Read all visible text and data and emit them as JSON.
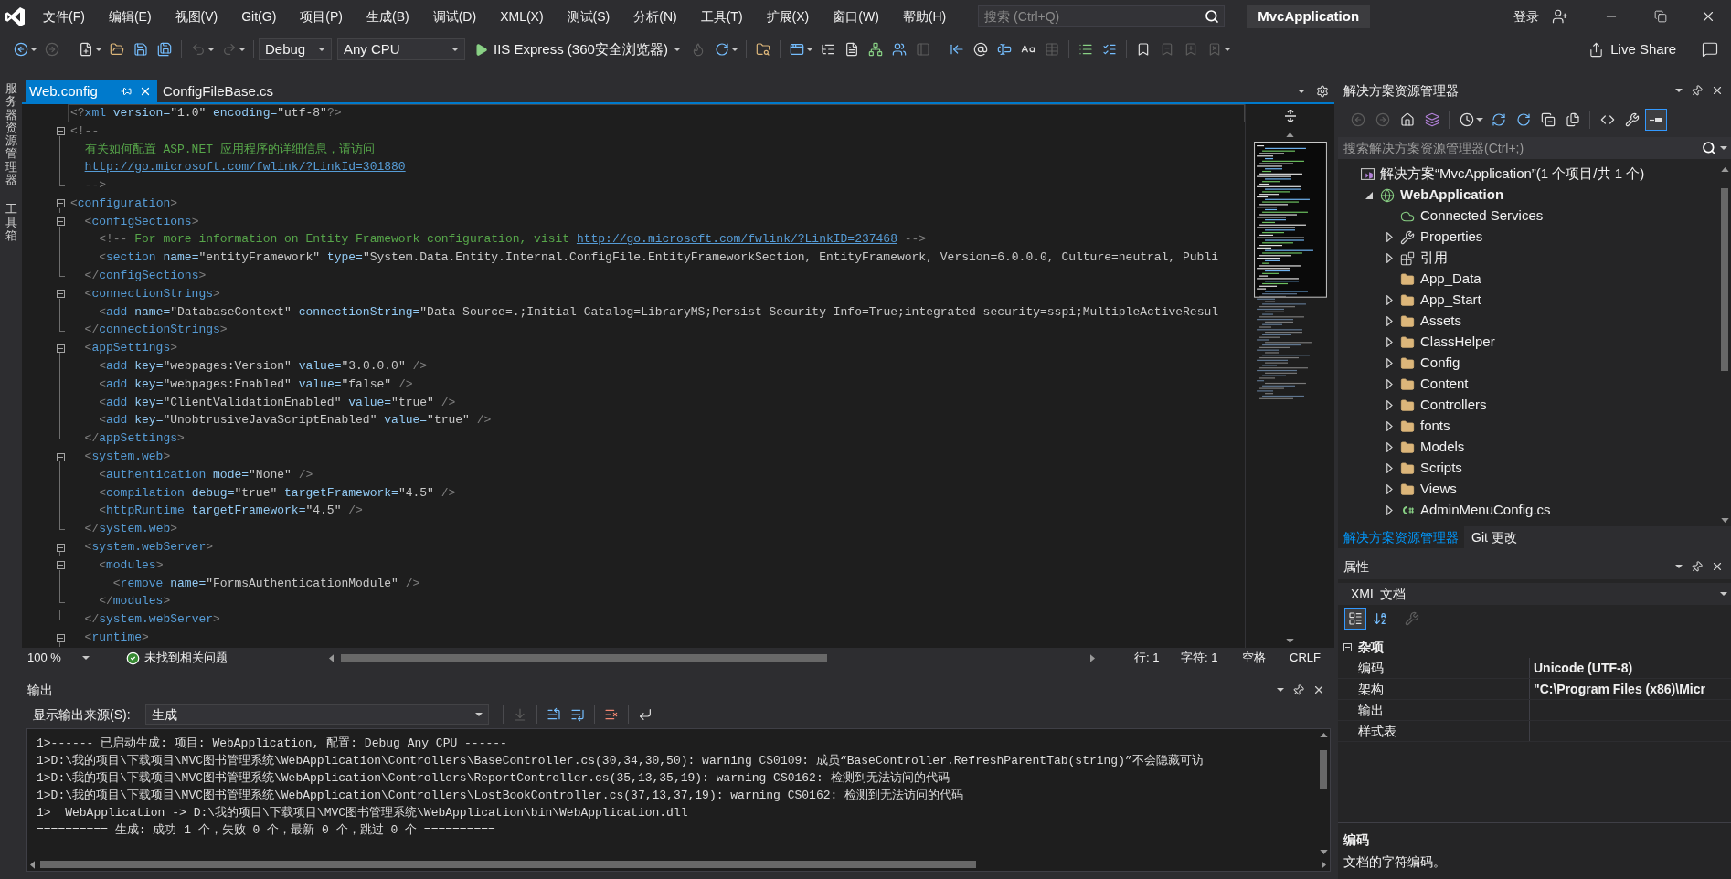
{
  "menu_bar": {
    "items": [
      "文件(F)",
      "编辑(E)",
      "视图(V)",
      "Git(G)",
      "项目(P)",
      "生成(B)",
      "调试(D)",
      "XML(X)",
      "测试(S)",
      "分析(N)",
      "工具(T)",
      "扩展(X)",
      "窗口(W)",
      "帮助(H)"
    ],
    "search": {
      "placeholder": "搜索 (Ctrl+Q)"
    },
    "title": "MvcApplication",
    "sign_in": "登录"
  },
  "toolbar": {
    "groups": [
      [
        {
          "kind": "back",
          "disabled": false,
          "menu": true
        },
        {
          "kind": "forward",
          "disabled": true,
          "menu": false
        }
      ],
      [
        {
          "kind": "new-item",
          "disabled": false,
          "menu": true
        },
        {
          "kind": "open",
          "disabled": false,
          "menu": false
        },
        {
          "kind": "save",
          "disabled": false,
          "menu": false
        },
        {
          "kind": "save-all",
          "disabled": false,
          "menu": false
        }
      ],
      [
        {
          "kind": "undo",
          "disabled": true,
          "menu": true
        },
        {
          "kind": "redo",
          "disabled": true,
          "menu": true
        }
      ],
      [
        {
          "kind": "combo",
          "value": "Debug",
          "disabled": false
        },
        {
          "kind": "combo",
          "value": "Any CPU",
          "disabled": false
        },
        {
          "kind": "run",
          "label": "IIS Express (360安全浏览器)",
          "disabled": false,
          "menu": true
        },
        {
          "kind": "hot-reload",
          "disabled": true,
          "menu": false
        },
        {
          "kind": "restart",
          "disabled": false,
          "menu": true
        }
      ],
      [
        {
          "kind": "find-folder",
          "disabled": false,
          "menu": false
        }
      ],
      [
        {
          "kind": "browse",
          "disabled": false,
          "menu": true
        },
        {
          "kind": "outline",
          "disabled": false,
          "menu": false
        },
        {
          "kind": "document",
          "disabled": false,
          "menu": false
        },
        {
          "kind": "hierarchy",
          "disabled": false,
          "menu": false
        },
        {
          "kind": "people",
          "disabled": false,
          "menu": false
        },
        {
          "kind": "panel",
          "disabled": true,
          "menu": false
        }
      ],
      [
        {
          "kind": "outdent",
          "disabled": false,
          "menu": false
        },
        {
          "kind": "at",
          "disabled": false,
          "menu": false
        },
        {
          "kind": "insert",
          "disabled": false,
          "menu": false
        },
        {
          "kind": "format",
          "disabled": false,
          "menu": false
        },
        {
          "kind": "table",
          "disabled": true,
          "menu": false
        }
      ],
      [
        {
          "kind": "comment",
          "disabled": false,
          "menu": false
        },
        {
          "kind": "uncomment",
          "disabled": false,
          "menu": false
        }
      ],
      [
        {
          "kind": "bookmark",
          "disabled": false,
          "menu": false
        },
        {
          "kind": "bookmark-prev",
          "disabled": true,
          "menu": false
        },
        {
          "kind": "bookmark-next",
          "disabled": true,
          "menu": false
        },
        {
          "kind": "bookmark-clear",
          "disabled": true,
          "menu": true
        }
      ]
    ],
    "live_share": "Live Share"
  },
  "side_tabs": [
    "服务器资源管理器",
    "工具箱"
  ],
  "editor": {
    "tabs": [
      {
        "label": "Web.config",
        "selected": true
      },
      {
        "label": "ConfigFileBase.cs",
        "selected": false
      }
    ],
    "lines": [
      {
        "kind": "plain",
        "current": true,
        "tokens": [
          {
            "kind": "delimiter",
            "text": "<?"
          },
          {
            "kind": "element",
            "text": "xml"
          },
          {
            "kind": "attribute",
            "text": " version="
          },
          {
            "kind": "value",
            "text": "\"1.0\""
          },
          {
            "kind": "attribute",
            "text": " encoding="
          },
          {
            "kind": "value",
            "text": "\"utf-8\""
          },
          {
            "kind": "delimiter",
            "text": "?>"
          }
        ]
      },
      {
        "kind": "start",
        "current": false,
        "tokens": [
          {
            "kind": "delimiter",
            "text": "<!--"
          }
        ]
      },
      {
        "kind": "inner",
        "current": false,
        "tokens": [
          {
            "kind": "comment",
            "text": "  有关如何配置 ASP.NET 应用程序的详细信息，请访问"
          }
        ]
      },
      {
        "kind": "inner",
        "current": false,
        "tokens": [
          {
            "kind": "link",
            "text": "  http://go.microsoft.com/fwlink/?LinkId=301880"
          }
        ]
      },
      {
        "kind": "end",
        "current": false,
        "tokens": [
          {
            "kind": "delimiter",
            "text": "  -->"
          }
        ]
      },
      {
        "kind": "start",
        "current": false,
        "tokens": [
          {
            "kind": "delimiter",
            "text": "<"
          },
          {
            "kind": "element",
            "text": "configuration"
          },
          {
            "kind": "delimiter",
            "text": ">"
          }
        ]
      },
      {
        "kind": "start",
        "current": false,
        "tokens": [
          {
            "kind": "delimiter",
            "text": "  <"
          },
          {
            "kind": "element",
            "text": "configSections"
          },
          {
            "kind": "delimiter",
            "text": ">"
          }
        ]
      },
      {
        "kind": "inner",
        "current": false,
        "tokens": [
          {
            "kind": "delimiter",
            "text": "    <!--"
          },
          {
            "kind": "comment",
            "text": " For more information on Entity Framework configuration, visit "
          },
          {
            "kind": "link",
            "text": "http://go.microsoft.com/fwlink/?LinkID=237468"
          },
          {
            "kind": "delimiter",
            "text": " -->"
          }
        ]
      },
      {
        "kind": "inner",
        "current": false,
        "tokens": [
          {
            "kind": "delimiter",
            "text": "    <"
          },
          {
            "kind": "element",
            "text": "section"
          },
          {
            "kind": "attribute",
            "text": " name="
          },
          {
            "kind": "value",
            "text": "\"entityFramework\""
          },
          {
            "kind": "attribute",
            "text": " type="
          },
          {
            "kind": "value",
            "text": "\"System.Data.Entity.Internal.ConfigFile.EntityFrameworkSection, EntityFramework, Version=6.0.0.0, Culture=neutral, Publi"
          }
        ]
      },
      {
        "kind": "end",
        "current": false,
        "tokens": [
          {
            "kind": "delimiter",
            "text": "  </"
          },
          {
            "kind": "element",
            "text": "configSections"
          },
          {
            "kind": "delimiter",
            "text": ">"
          }
        ]
      },
      {
        "kind": "start",
        "current": false,
        "tokens": [
          {
            "kind": "delimiter",
            "text": "  <"
          },
          {
            "kind": "element",
            "text": "connectionStrings"
          },
          {
            "kind": "delimiter",
            "text": ">"
          }
        ]
      },
      {
        "kind": "inner",
        "current": false,
        "tokens": [
          {
            "kind": "delimiter",
            "text": "    <"
          },
          {
            "kind": "element",
            "text": "add"
          },
          {
            "kind": "attribute",
            "text": " name="
          },
          {
            "kind": "value",
            "text": "\"DatabaseContext\""
          },
          {
            "kind": "attribute",
            "text": " connectionString="
          },
          {
            "kind": "value",
            "text": "\"Data Source=.;Initial Catalog=LibraryMS;Persist Security Info=True;integrated security=sspi;MultipleActiveResul"
          }
        ]
      },
      {
        "kind": "end",
        "current": false,
        "tokens": [
          {
            "kind": "delimiter",
            "text": "  </"
          },
          {
            "kind": "element",
            "text": "connectionStrings"
          },
          {
            "kind": "delimiter",
            "text": ">"
          }
        ]
      },
      {
        "kind": "start",
        "current": false,
        "tokens": [
          {
            "kind": "delimiter",
            "text": "  <"
          },
          {
            "kind": "element",
            "text": "appSettings"
          },
          {
            "kind": "delimiter",
            "text": ">"
          }
        ]
      },
      {
        "kind": "inner",
        "current": false,
        "tokens": [
          {
            "kind": "delimiter",
            "text": "    <"
          },
          {
            "kind": "element",
            "text": "add"
          },
          {
            "kind": "attribute",
            "text": " key="
          },
          {
            "kind": "value",
            "text": "\"webpages:Version\""
          },
          {
            "kind": "attribute",
            "text": " value="
          },
          {
            "kind": "value",
            "text": "\"3.0.0.0\""
          },
          {
            "kind": "delimiter",
            "text": " />"
          }
        ]
      },
      {
        "kind": "inner",
        "current": false,
        "tokens": [
          {
            "kind": "delimiter",
            "text": "    <"
          },
          {
            "kind": "element",
            "text": "add"
          },
          {
            "kind": "attribute",
            "text": " key="
          },
          {
            "kind": "value",
            "text": "\"webpages:Enabled\""
          },
          {
            "kind": "attribute",
            "text": " value="
          },
          {
            "kind": "value",
            "text": "\"false\""
          },
          {
            "kind": "delimiter",
            "text": " />"
          }
        ]
      },
      {
        "kind": "inner",
        "current": false,
        "tokens": [
          {
            "kind": "delimiter",
            "text": "    <"
          },
          {
            "kind": "element",
            "text": "add"
          },
          {
            "kind": "attribute",
            "text": " key="
          },
          {
            "kind": "value",
            "text": "\"ClientValidationEnabled\""
          },
          {
            "kind": "attribute",
            "text": " value="
          },
          {
            "kind": "value",
            "text": "\"true\""
          },
          {
            "kind": "delimiter",
            "text": " />"
          }
        ]
      },
      {
        "kind": "inner",
        "current": false,
        "tokens": [
          {
            "kind": "delimiter",
            "text": "    <"
          },
          {
            "kind": "element",
            "text": "add"
          },
          {
            "kind": "attribute",
            "text": " key="
          },
          {
            "kind": "value",
            "text": "\"UnobtrusiveJavaScriptEnabled\""
          },
          {
            "kind": "attribute",
            "text": " value="
          },
          {
            "kind": "value",
            "text": "\"true\""
          },
          {
            "kind": "delimiter",
            "text": " />"
          }
        ]
      },
      {
        "kind": "end",
        "current": false,
        "tokens": [
          {
            "kind": "delimiter",
            "text": "  </"
          },
          {
            "kind": "element",
            "text": "appSettings"
          },
          {
            "kind": "delimiter",
            "text": ">"
          }
        ]
      },
      {
        "kind": "start",
        "current": false,
        "tokens": [
          {
            "kind": "delimiter",
            "text": "  <"
          },
          {
            "kind": "element",
            "text": "system.web"
          },
          {
            "kind": "delimiter",
            "text": ">"
          }
        ]
      },
      {
        "kind": "inner",
        "current": false,
        "tokens": [
          {
            "kind": "delimiter",
            "text": "    <"
          },
          {
            "kind": "element",
            "text": "authentication"
          },
          {
            "kind": "attribute",
            "text": " mode="
          },
          {
            "kind": "value",
            "text": "\"None\""
          },
          {
            "kind": "delimiter",
            "text": " />"
          }
        ]
      },
      {
        "kind": "inner",
        "current": false,
        "tokens": [
          {
            "kind": "delimiter",
            "text": "    <"
          },
          {
            "kind": "element",
            "text": "compilation"
          },
          {
            "kind": "attribute",
            "text": " debug="
          },
          {
            "kind": "value",
            "text": "\"true\""
          },
          {
            "kind": "attribute",
            "text": " targetFramework="
          },
          {
            "kind": "value",
            "text": "\"4.5\""
          },
          {
            "kind": "delimiter",
            "text": " />"
          }
        ]
      },
      {
        "kind": "inner",
        "current": false,
        "tokens": [
          {
            "kind": "delimiter",
            "text": "    <"
          },
          {
            "kind": "element",
            "text": "httpRuntime"
          },
          {
            "kind": "attribute",
            "text": " targetFramework="
          },
          {
            "kind": "value",
            "text": "\"4.5\""
          },
          {
            "kind": "delimiter",
            "text": " />"
          }
        ]
      },
      {
        "kind": "end",
        "current": false,
        "tokens": [
          {
            "kind": "delimiter",
            "text": "  </"
          },
          {
            "kind": "element",
            "text": "system.web"
          },
          {
            "kind": "delimiter",
            "text": ">"
          }
        ]
      },
      {
        "kind": "start",
        "current": false,
        "tokens": [
          {
            "kind": "delimiter",
            "text": "  <"
          },
          {
            "kind": "element",
            "text": "system.webServer"
          },
          {
            "kind": "delimiter",
            "text": ">"
          }
        ]
      },
      {
        "kind": "start",
        "current": false,
        "tokens": [
          {
            "kind": "delimiter",
            "text": "    <"
          },
          {
            "kind": "element",
            "text": "modules"
          },
          {
            "kind": "delimiter",
            "text": ">"
          }
        ]
      },
      {
        "kind": "inner",
        "current": false,
        "tokens": [
          {
            "kind": "delimiter",
            "text": "      <"
          },
          {
            "kind": "element",
            "text": "remove"
          },
          {
            "kind": "attribute",
            "text": " name="
          },
          {
            "kind": "value",
            "text": "\"FormsAuthenticationModule\""
          },
          {
            "kind": "delimiter",
            "text": " />"
          }
        ]
      },
      {
        "kind": "end",
        "current": false,
        "tokens": [
          {
            "kind": "delimiter",
            "text": "    </"
          },
          {
            "kind": "element",
            "text": "modules"
          },
          {
            "kind": "delimiter",
            "text": ">"
          }
        ]
      },
      {
        "kind": "end",
        "current": false,
        "tokens": [
          {
            "kind": "delimiter",
            "text": "  </"
          },
          {
            "kind": "element",
            "text": "system.webServer"
          },
          {
            "kind": "delimiter",
            "text": ">"
          }
        ]
      },
      {
        "kind": "start",
        "current": false,
        "tokens": [
          {
            "kind": "delimiter",
            "text": "  <"
          },
          {
            "kind": "element",
            "text": "runtime"
          },
          {
            "kind": "delimiter",
            "text": ">"
          }
        ]
      }
    ],
    "status": {
      "zoom": "100 %",
      "issues": "未找到相关问题",
      "line": "行: 1",
      "column": "字符: 1",
      "indent": "空格",
      "line_ending": "CRLF"
    }
  },
  "output": {
    "title": "输出",
    "source_label": "显示输出来源(S):",
    "source": "生成",
    "toolbar": [
      [
        {
          "kind": "previous-location",
          "disabled": true
        }
      ],
      [
        {
          "kind": "previous-message",
          "disabled": false
        },
        {
          "kind": "next-message",
          "disabled": false
        }
      ],
      [
        {
          "kind": "clear",
          "disabled": false
        }
      ],
      [
        {
          "kind": "word-wrap",
          "disabled": false
        }
      ]
    ],
    "lines": [
      "1>------ 已启动生成: 项目: WebApplication, 配置: Debug Any CPU ------",
      "1>D:\\我的项目\\下载项目\\MVC图书管理系统\\WebApplication\\Controllers\\BaseController.cs(30,34,30,50): warning CS0109: 成员“BaseController.RefreshParentTab(string)”不会隐藏可访",
      "1>D:\\我的项目\\下载项目\\MVC图书管理系统\\WebApplication\\Controllers\\ReportController.cs(35,13,35,19): warning CS0162: 检测到无法访问的代码",
      "1>D:\\我的项目\\下载项目\\MVC图书管理系统\\WebApplication\\Controllers\\LostBookController.cs(37,13,37,19): warning CS0162: 检测到无法访问的代码",
      "1>  WebApplication -> D:\\我的项目\\下载项目\\MVC图书管理系统\\WebApplication\\bin\\WebApplication.dll",
      "========== 生成: 成功 1 个，失败 0 个，最新 0 个，跳过 0 个 =========="
    ]
  },
  "solution_explorer": {
    "title": "解决方案资源管理器",
    "toolbar": [
      [
        {
          "kind": "back",
          "disabled": true,
          "on": false,
          "menu": false
        },
        {
          "kind": "forward",
          "disabled": true,
          "on": false,
          "menu": false
        },
        {
          "kind": "home",
          "disabled": false,
          "on": false,
          "menu": false
        },
        {
          "kind": "switch-views",
          "disabled": false,
          "on": false,
          "menu": false
        }
      ],
      [
        {
          "kind": "pending-changes",
          "disabled": false,
          "on": false,
          "menu": true
        },
        {
          "kind": "sync",
          "disabled": false,
          "on": false,
          "menu": false
        },
        {
          "kind": "refresh",
          "disabled": false,
          "on": false,
          "menu": false
        },
        {
          "kind": "collapse",
          "disabled": false,
          "on": false,
          "menu": false
        },
        {
          "kind": "show-all",
          "disabled": false,
          "on": false,
          "menu": false
        }
      ],
      [
        {
          "kind": "view-code",
          "disabled": false,
          "on": false,
          "menu": false
        },
        {
          "kind": "properties",
          "disabled": false,
          "on": false,
          "menu": false
        },
        {
          "kind": "preview",
          "disabled": false,
          "on": true,
          "menu": false
        }
      ]
    ],
    "search": {
      "placeholder": "搜索解决方案资源管理器(Ctrl+;)"
    },
    "tree": [
      {
        "kind": "solution",
        "label": "解决方案“MvcApplication”(1 个项目/共 1 个)",
        "children": [
          {
            "kind": "project",
            "label": "WebApplication",
            "expanded": true,
            "children": [
              {
                "kind": "connected-services",
                "label": "Connected Services"
              },
              {
                "kind": "properties",
                "label": "Properties",
                "expanded": false
              },
              {
                "kind": "references",
                "label": "引用",
                "expanded": false
              },
              {
                "kind": "folder",
                "label": "App_Data"
              },
              {
                "kind": "folder",
                "label": "App_Start",
                "expanded": false
              },
              {
                "kind": "folder",
                "label": "Assets",
                "expanded": false
              },
              {
                "kind": "folder",
                "label": "ClassHelper",
                "expanded": false
              },
              {
                "kind": "folder",
                "label": "Config",
                "expanded": false
              },
              {
                "kind": "folder",
                "label": "Content",
                "expanded": false
              },
              {
                "kind": "folder",
                "label": "Controllers",
                "expanded": false
              },
              {
                "kind": "folder",
                "label": "fonts",
                "expanded": false
              },
              {
                "kind": "folder",
                "label": "Models",
                "expanded": false
              },
              {
                "kind": "folder",
                "label": "Scripts",
                "expanded": false
              },
              {
                "kind": "folder",
                "label": "Views",
                "expanded": false
              },
              {
                "kind": "code-file",
                "label": "AdminMenuConfig.cs",
                "expanded": false
              }
            ]
          }
        ]
      }
    ],
    "tabs": [
      {
        "label": "解决方案资源管理器",
        "selected": true
      },
      {
        "label": "Git 更改",
        "selected": false
      }
    ]
  },
  "properties": {
    "title": "属性",
    "object": "XML 文档",
    "toolbar": [
      [
        {
          "kind": "categorized",
          "disabled": false,
          "on": true
        },
        {
          "kind": "alphabetical",
          "disabled": false,
          "on": false
        }
      ],
      [
        {
          "kind": "property-pages",
          "disabled": true,
          "on": false
        }
      ]
    ],
    "categories": [
      {
        "name": "杂项",
        "expanded": true,
        "rows": [
          {
            "name": "编码",
            "value": "Unicode (UTF-8)"
          },
          {
            "name": "架构",
            "value": "\"C:\\Program Files (x86)\\Micr"
          },
          {
            "name": "输出"
          },
          {
            "name": "样式表"
          }
        ]
      }
    ],
    "description": {
      "title": "编码",
      "text": "文档的字符编码。"
    }
  }
}
